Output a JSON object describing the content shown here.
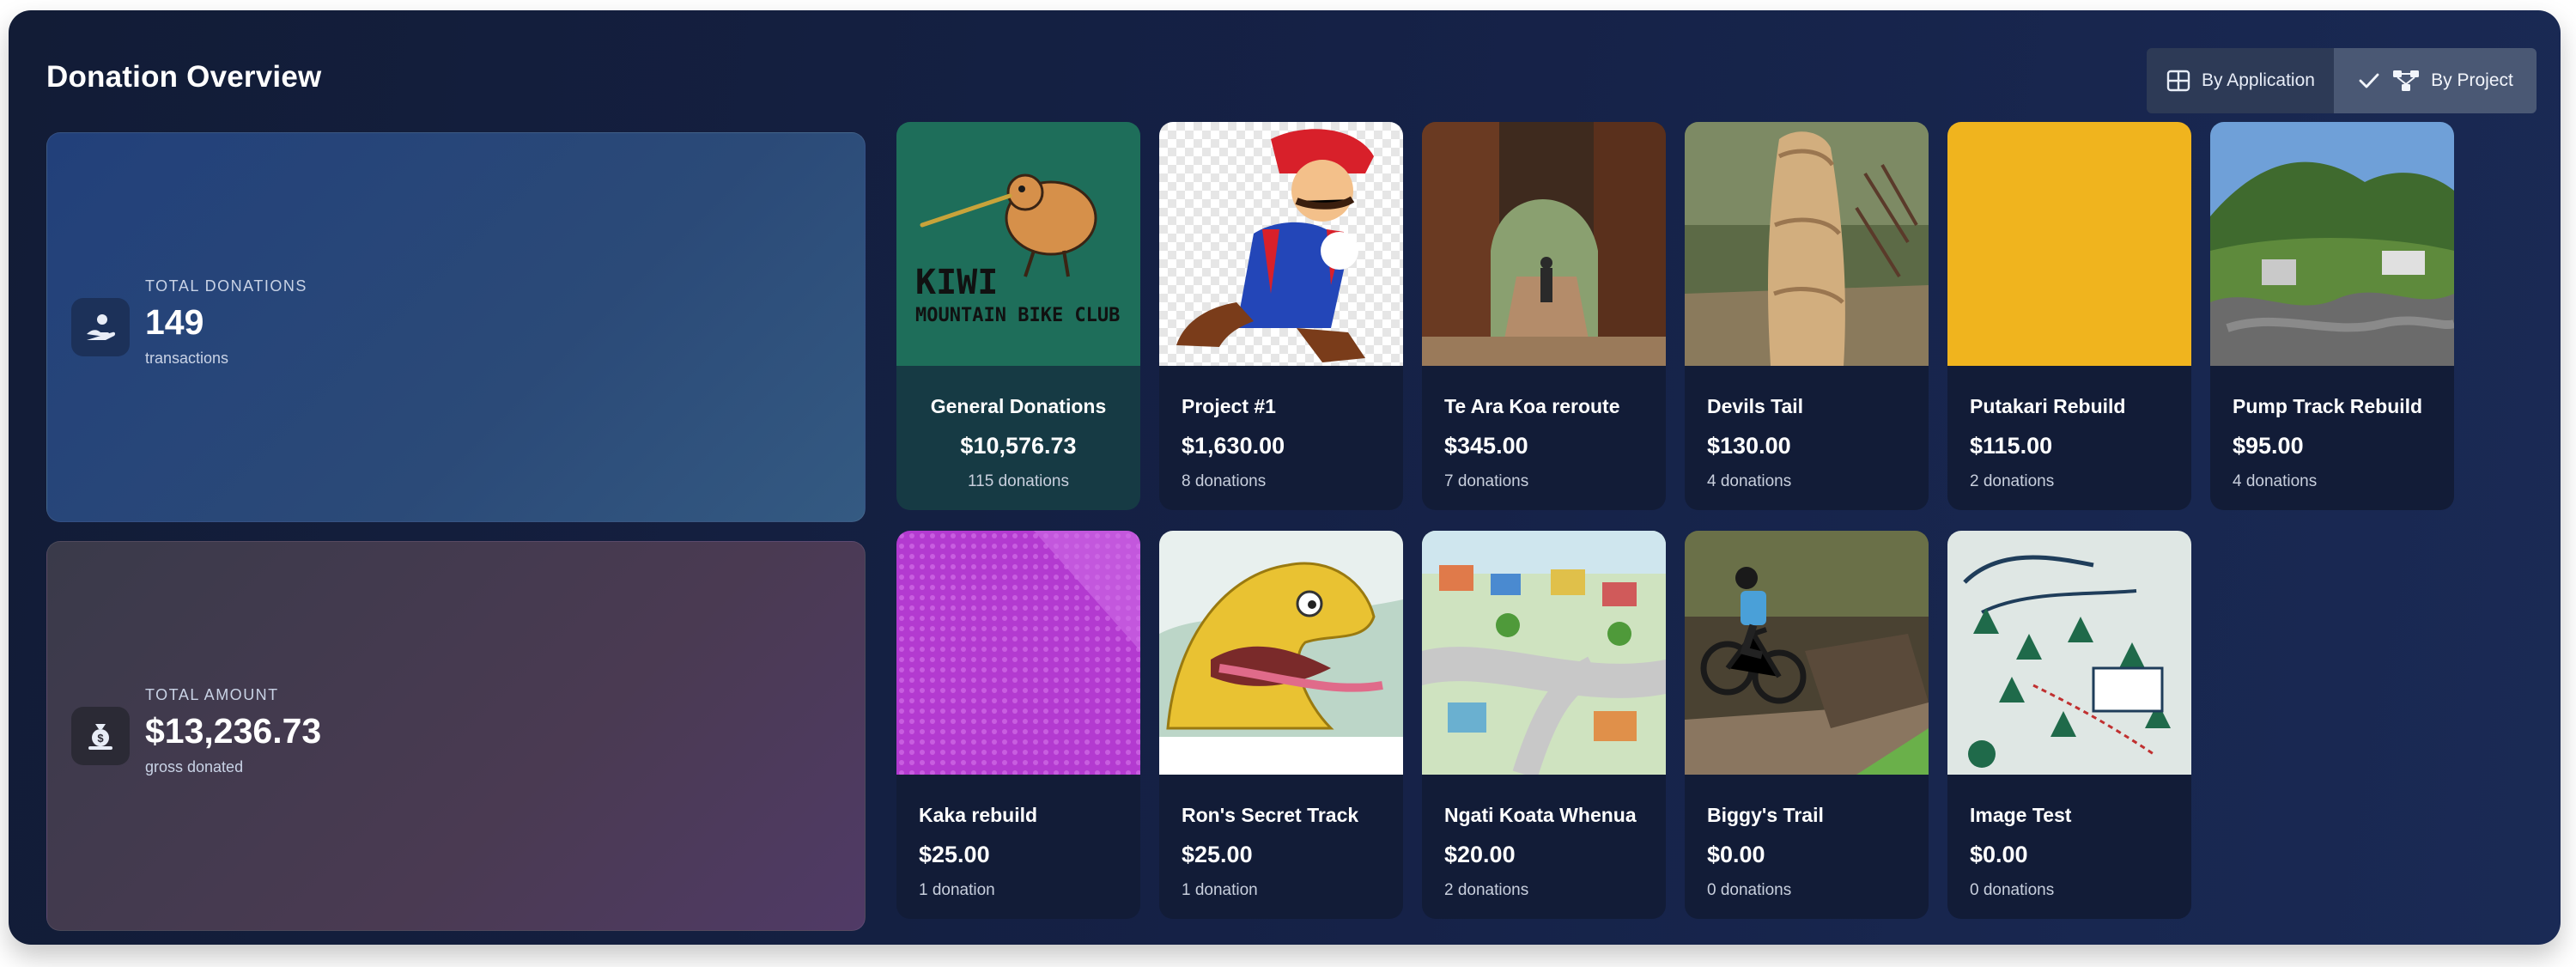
{
  "header": {
    "title": "Donation Overview"
  },
  "toggle": {
    "by_application": "By Application",
    "by_project": "By Project"
  },
  "stats": {
    "total_donations": {
      "label": "TOTAL DONATIONS",
      "value": "149",
      "sub": "transactions"
    },
    "total_amount": {
      "label": "TOTAL AMOUNT",
      "value": "$13,236.73",
      "sub": "gross donated"
    }
  },
  "projects": [
    {
      "name": "General Donations",
      "amount": "$10,576.73",
      "count": "115 donations",
      "logo_line1": "KIWI",
      "logo_line2": "MOUNTAIN BIKE CLUB"
    },
    {
      "name": "Project #1",
      "amount": "$1,630.00",
      "count": "8 donations"
    },
    {
      "name": "Te Ara Koa reroute",
      "amount": "$345.00",
      "count": "7 donations"
    },
    {
      "name": "Devils Tail",
      "amount": "$130.00",
      "count": "4 donations"
    },
    {
      "name": "Putakari Rebuild",
      "amount": "$115.00",
      "count": "2 donations"
    },
    {
      "name": "Pump Track Rebuild",
      "amount": "$95.00",
      "count": "4 donations"
    },
    {
      "name": "Kaka rebuild",
      "amount": "$25.00",
      "count": "1 donation"
    },
    {
      "name": "Ron's Secret Track",
      "amount": "$25.00",
      "count": "1 donation"
    },
    {
      "name": "Ngati Koata Whenua",
      "amount": "$20.00",
      "count": "2 donations"
    },
    {
      "name": "Biggy's Trail",
      "amount": "$0.00",
      "count": "0 donations"
    },
    {
      "name": "Image Test",
      "amount": "$0.00",
      "count": "0 donations"
    }
  ],
  "colors": {
    "panel_bg": "#152146",
    "card_bg": "#121c37",
    "highlight_card_bg": "#163a44",
    "toggle_active": "#4a5874"
  },
  "icons": {
    "toggle_application": "grid-icon",
    "toggle_project": "hierarchy-icon",
    "toggle_selected": "check-icon",
    "stat_donations": "hand-receive-icon",
    "stat_amount": "money-bag-icon"
  }
}
